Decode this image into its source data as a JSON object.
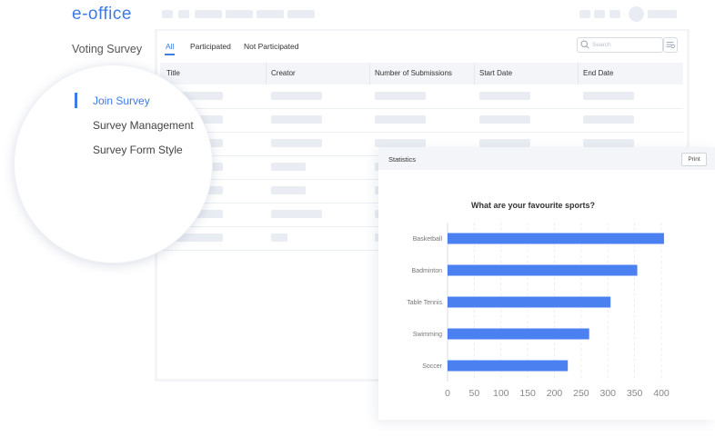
{
  "app": {
    "logo": "e-office"
  },
  "sidebar": {
    "title": "Voting Survey"
  },
  "lens_menu": {
    "items": [
      {
        "label": "Join Survey",
        "active": true
      },
      {
        "label": "Survey Management",
        "active": false
      },
      {
        "label": "Survey Form Style",
        "active": false
      }
    ]
  },
  "tabs": [
    {
      "label": "All",
      "active": true
    },
    {
      "label": "Participated",
      "active": false
    },
    {
      "label": "Not Participated",
      "active": false
    }
  ],
  "search": {
    "placeholder": "Search"
  },
  "table": {
    "columns": [
      "Title",
      "Creator",
      "Number of Submissions",
      "Start Date",
      "End Date"
    ]
  },
  "statistics": {
    "title": "Statistics",
    "print_label": "Print"
  },
  "colors": {
    "accent": "#3f7be6",
    "bar": "#4b80f0"
  },
  "icons": [
    "search-icon",
    "filter-icon"
  ],
  "chart_data": {
    "type": "bar",
    "orientation": "horizontal",
    "title": "What are your favourite sports?",
    "categories": [
      "Basketball",
      "Badminton",
      "Table Tennis",
      "Swimming",
      "Soccer"
    ],
    "values": [
      405,
      355,
      305,
      265,
      225
    ],
    "xlim": [
      0,
      400
    ],
    "xticks": [
      0,
      50,
      100,
      150,
      200,
      250,
      300,
      350,
      400
    ],
    "grid": true,
    "xlabel": "",
    "ylabel": ""
  }
}
